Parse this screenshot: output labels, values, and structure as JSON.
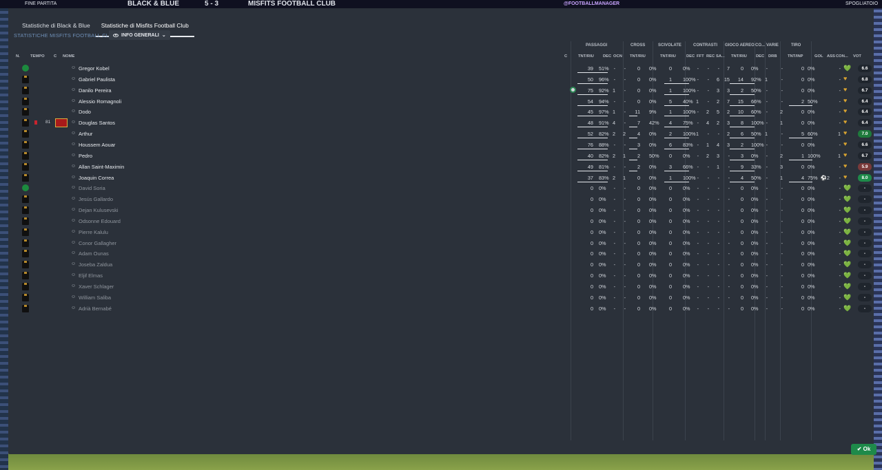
{
  "topbar": {
    "status": "FINE PARTITA",
    "home": "BLACK & BLUE",
    "score": "5 - 3",
    "away": "MISFITS FOOTBALL CLUB",
    "tag": "@FOOTBALLMANAGER",
    "right": "SPOGLIATOIO"
  },
  "tabs": [
    {
      "label": "Statistiche di Black & Blue",
      "active": false
    },
    {
      "label": "Statistiche di Misfits Football Club",
      "active": true
    }
  ],
  "sublink": "STATISTICHE MISFITS FOOTBALL CLUB",
  "dropdown": {
    "label": "INFO GENERALI"
  },
  "groups": {
    "passaggi": "PASSAGGI",
    "cross": "CROSS",
    "scivolate": "SCIVOLATE",
    "contrasti": "CONTRASTI",
    "gioco_aereo": "GIOCO AEREO",
    "co": "CO...",
    "varie": "VARIE",
    "tiro": "TIRO"
  },
  "columns": {
    "n": "N.",
    "tempo": "TEMPO",
    "c": "C",
    "nome": "NOME",
    "c2": "C",
    "pass_tr": "TNT/RIU",
    "pass_dec": "DEC",
    "pass_ocn": "OCN",
    "cross_tr": "TNT/RIU",
    "sciv_tr": "TNT/RIU",
    "con_dec": "DEC",
    "con_fft": "FFT",
    "con_rec": "REC",
    "con_sa": "SA...",
    "aereo_tr": "TNT/RIU",
    "co_dec": "DEC",
    "drb": "DRB",
    "tiro_tr": "TNT/INP",
    "gol": "GOL",
    "ass": "ASS",
    "con": "CON...",
    "vot": "VOT"
  },
  "players": [
    {
      "num": "1",
      "gk": true,
      "name": "Gregor Kobel",
      "pT": "39",
      "pP": "51%",
      "pD": "-",
      "pO": "-",
      "cT": "0",
      "cP": "0%",
      "sT": "0",
      "sP": "0%",
      "k1": "-",
      "k2": "-",
      "k3": "-",
      "k4": "7",
      "aT": "0",
      "aP": "0%",
      "coD": "-",
      "drb": "-",
      "tT": "0",
      "tP": "0%",
      "gol": "",
      "ass": "-",
      "vot": "6.6",
      "votBg": "#1f252d",
      "sub": false
    },
    {
      "num": "5",
      "name": "Gabriel Paulista",
      "pT": "50",
      "pP": "96%",
      "pD": "-",
      "pO": "-",
      "cT": "0",
      "cP": "0%",
      "sT": "1",
      "sP": "100%",
      "k1": "-",
      "k2": "-",
      "k3": "6",
      "k4": "15",
      "aT": "14",
      "aP": "92%",
      "coD": "1",
      "drb": "-",
      "tT": "0",
      "tP": "0%",
      "gol": "",
      "ass": "-",
      "vot": "6.8",
      "votBg": "#1f252d",
      "sub": false
    },
    {
      "num": "3",
      "name": "Danilo Pereira",
      "cIcon": true,
      "pT": "75",
      "pP": "92%",
      "pD": "1",
      "pO": "-",
      "cT": "0",
      "cP": "0%",
      "sT": "1",
      "sP": "100%",
      "k1": "-",
      "k2": "-",
      "k3": "3",
      "k4": "3",
      "aT": "2",
      "aP": "50%",
      "coD": "-",
      "drb": "-",
      "tT": "0",
      "tP": "0%",
      "gol": "",
      "ass": "-",
      "vot": "6.7",
      "votBg": "#1f252d",
      "sub": false
    },
    {
      "num": "13",
      "name": "Alessio Romagnoli",
      "pT": "54",
      "pP": "94%",
      "pD": "-",
      "pO": "-",
      "cT": "0",
      "cP": "0%",
      "sT": "5",
      "sP": "40%",
      "k1": "1",
      "k2": "-",
      "k3": "2",
      "k4": "7",
      "aT": "15",
      "aP": "66%",
      "coD": "-",
      "drb": "-",
      "tT": "2",
      "tP": "50%",
      "gol": "",
      "ass": "-",
      "vot": "6.4",
      "votBg": "#1f252d",
      "sub": false
    },
    {
      "num": "2",
      "name": "Dodo",
      "pT": "45",
      "pP": "97%",
      "pD": "1",
      "pO": "-",
      "cT": "11",
      "cP": "9%",
      "sT": "1",
      "sP": "100%",
      "k1": "-",
      "k2": "2",
      "k3": "5",
      "k4": "2",
      "aT": "10",
      "aP": "60%",
      "coD": "-",
      "drb": "2",
      "tT": "0",
      "tP": "0%",
      "gol": "",
      "ass": "-",
      "vot": "6.4",
      "votBg": "#1f252d",
      "sub": false
    },
    {
      "num": "6",
      "name": "Douglas Santos",
      "card": true,
      "time": "81",
      "capt": true,
      "pT": "48",
      "pP": "91%",
      "pD": "4",
      "pO": "-",
      "cT": "7",
      "cP": "42%",
      "sT": "4",
      "sP": "75%",
      "k1": "-",
      "k2": "4",
      "k3": "2",
      "k4": "3",
      "aT": "8",
      "aP": "100%",
      "coD": "-",
      "drb": "1",
      "tT": "0",
      "tP": "0%",
      "gol": "",
      "ass": "-",
      "vot": "6.4",
      "votBg": "#1f252d",
      "sub": false
    },
    {
      "num": "8",
      "name": "Arthur",
      "pT": "52",
      "pP": "82%",
      "pD": "2",
      "pO": "2",
      "cT": "4",
      "cP": "0%",
      "sT": "2",
      "sP": "100%",
      "k1": "1",
      "k2": "-",
      "k3": "-",
      "k4": "2",
      "aT": "6",
      "aP": "50%",
      "coD": "1",
      "drb": "-",
      "tT": "5",
      "tP": "60%",
      "gol": "",
      "ass": "1",
      "vot": "7.0",
      "votBg": "#1e7a3c",
      "sub": false
    },
    {
      "num": "7",
      "name": "Houssem Aouar",
      "pT": "76",
      "pP": "88%",
      "pD": "-",
      "pO": "-",
      "cT": "3",
      "cP": "0%",
      "sT": "6",
      "sP": "83%",
      "k1": "-",
      "k2": "1",
      "k3": "4",
      "k4": "3",
      "aT": "2",
      "aP": "100%",
      "coD": "-",
      "drb": "-",
      "tT": "0",
      "tP": "0%",
      "gol": "",
      "ass": "-",
      "vot": "6.6",
      "votBg": "#1f252d",
      "sub": false
    },
    {
      "num": "10",
      "name": "Pedro",
      "pT": "40",
      "pP": "82%",
      "pD": "2",
      "pO": "1",
      "cT": "2",
      "cP": "50%",
      "sT": "0",
      "sP": "0%",
      "k1": "-",
      "k2": "2",
      "k3": "3",
      "k4": "-",
      "aT": "3",
      "aP": "0%",
      "coD": "-",
      "drb": "2",
      "tT": "1",
      "tP": "100%",
      "gol": "",
      "ass": "1",
      "vot": "6.7",
      "votBg": "#1f252d",
      "sub": false
    },
    {
      "num": "11",
      "name": "Allan Saint-Maximin",
      "pT": "49",
      "pP": "81%",
      "pD": "-",
      "pO": "-",
      "cT": "2",
      "cP": "0%",
      "sT": "3",
      "sP": "66%",
      "k1": "-",
      "k2": "-",
      "k3": "1",
      "k4": "-",
      "aT": "9",
      "aP": "33%",
      "coD": "-",
      "drb": "3",
      "tT": "0",
      "tP": "0%",
      "gol": "",
      "ass": "-",
      "vot": "5.9",
      "votBg": "#7a3a3a",
      "sub": false
    },
    {
      "num": "9",
      "name": "Joaquin Correa",
      "pT": "37",
      "pP": "83%",
      "pD": "2",
      "pO": "1",
      "cT": "0",
      "cP": "0%",
      "sT": "1",
      "sP": "100%",
      "k1": "-",
      "k2": "-",
      "k3": "-",
      "k4": "-",
      "aT": "4",
      "aP": "50%",
      "coD": "-",
      "drb": "1",
      "tT": "4",
      "tP": "75%",
      "gol": "2",
      "ass": "-",
      "vot": "8.0",
      "votBg": "#1e8a4a",
      "sub": false
    },
    {
      "num": "12",
      "gk": true,
      "name": "David Soria",
      "sub": true
    },
    {
      "num": "14",
      "name": "Jesús Gallardo",
      "sub": true
    },
    {
      "num": "15",
      "name": "Dejan Kulusevski",
      "sub": true
    },
    {
      "num": "16",
      "name": "Odsonne Edouard",
      "sub": true
    },
    {
      "num": "17",
      "name": "Pierre Kalulu",
      "sub": true
    },
    {
      "num": "18",
      "name": "Conor Gallagher",
      "sub": true
    },
    {
      "num": "19",
      "name": "Adam Ounas",
      "sub": true
    },
    {
      "num": "20",
      "name": "Joseba Zaldua",
      "sub": true
    },
    {
      "num": "21",
      "name": "Eljif Elmas",
      "sub": true
    },
    {
      "num": "22",
      "name": "Xaver Schlager",
      "sub": true
    },
    {
      "num": "23",
      "name": "William Saliba",
      "sub": true
    },
    {
      "num": "24",
      "name": "Adrià Bernabé",
      "sub": true
    }
  ],
  "sub_defaults": {
    "pT": "0",
    "pP": "0%",
    "pD": "-",
    "pO": "-",
    "cT": "0",
    "cP": "0%",
    "sT": "0",
    "sP": "0%",
    "k1": "-",
    "k2": "-",
    "k3": "-",
    "k4": "-",
    "aT": "0",
    "aP": "0%",
    "coD": "-",
    "drb": "-",
    "tT": "0",
    "tP": "0%",
    "gol": "",
    "ass": "-",
    "vot": "-",
    "votBg": "#1f252d"
  },
  "ok_button": "Ok",
  "colors": {
    "accent_green": "#1e8a4a",
    "panel": "#2b313a",
    "bad_rating": "#7a3a3a"
  }
}
